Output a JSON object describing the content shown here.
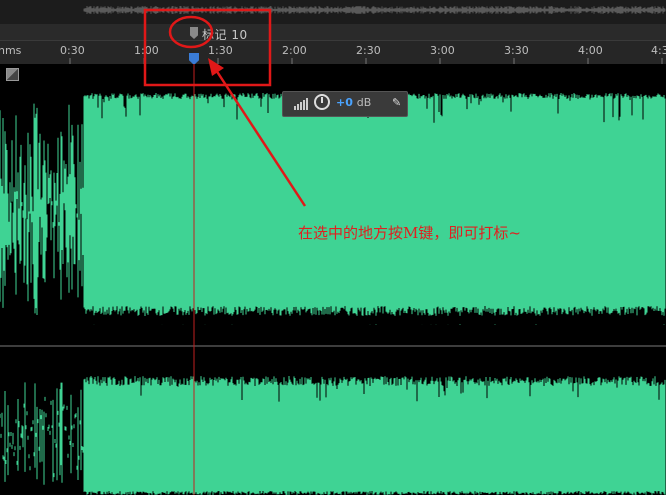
{
  "marker": {
    "label": "标记 10"
  },
  "ruler": {
    "ticks": [
      "hms",
      "0:30",
      "1:00",
      "1:30",
      "2:00",
      "2:30",
      "3:00",
      "3:30",
      "4:00",
      "4:3"
    ]
  },
  "hud": {
    "gain_value": "+0",
    "gain_unit": "dB"
  },
  "annotation": {
    "text": "在选中的地方按M键，即可打标~"
  },
  "colors": {
    "waveform": "#3fd394",
    "playhead": "#d02020",
    "selection_handle": "#3a7cd6",
    "annotation": "#e02020"
  },
  "icons": {
    "hud_level": "level-meter-icon",
    "hud_knob": "volume-knob-icon",
    "hud_pin": "pin-icon",
    "marker": "marker-flag-icon",
    "corner": "fit-view-icon"
  }
}
